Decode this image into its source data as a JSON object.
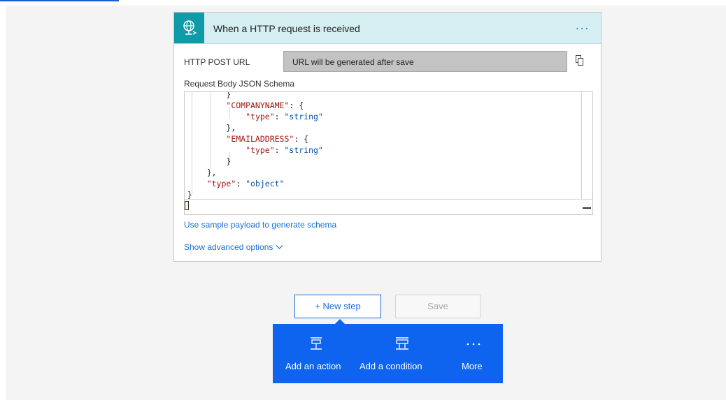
{
  "trigger": {
    "icon": "http-request-globe-icon",
    "title": "When a HTTP request is received",
    "menu": "...",
    "url_label": "HTTP POST URL",
    "url_value": "URL will be generated after save",
    "schema_label": "Request Body JSON Schema",
    "code_lines": [
      "        }",
      "        \"COMPANYNAME\": {",
      "            \"type\": \"string\"",
      "        },",
      "        \"EMAILADDRESS\": {",
      "            \"type\": \"string\"",
      "        }",
      "    },",
      "    \"type\": \"object\"",
      "}"
    ],
    "sample_link": "Use sample payload to generate schema",
    "advanced": "Show advanced options"
  },
  "actions": {
    "new_step": "+ New step",
    "save": "Save"
  },
  "flyout": {
    "items": [
      {
        "label": "Add an action",
        "icon": "add-action-icon"
      },
      {
        "label": "Add a condition",
        "icon": "add-condition-icon"
      },
      {
        "label": "More",
        "icon": "more-ellipsis-icon"
      }
    ]
  },
  "colors": {
    "accent": "#1a6fd6",
    "trigger_icon_bg": "#0e9aa7",
    "header_bg": "#d5eef2",
    "flyout_bg": "#0e63ef"
  }
}
